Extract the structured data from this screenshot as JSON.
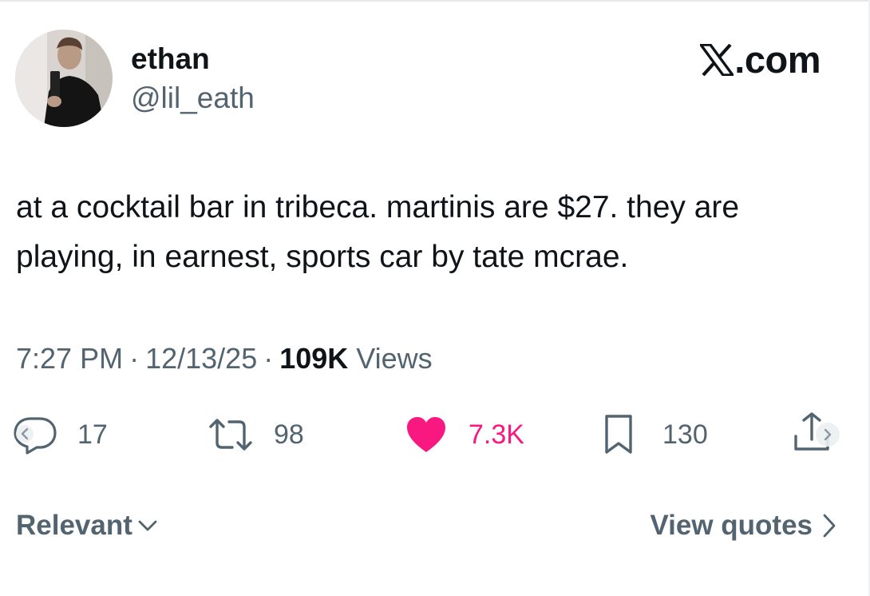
{
  "user": {
    "display_name": "ethan",
    "handle": "@lil_eath"
  },
  "brand": {
    "icon": "x-logo-icon",
    "text": ".com"
  },
  "tweet": {
    "text": "at a cocktail bar in tribeca. martinis are $27. they are playing, in earnest, sports car by tate mcrae."
  },
  "meta": {
    "time": "7:27 PM",
    "date": "12/13/25",
    "views_count": "109K",
    "views_label": "Views",
    "separator": "·"
  },
  "actions": {
    "reply": {
      "icon": "reply-bubble-icon",
      "count": "17"
    },
    "repost": {
      "icon": "repost-icon",
      "count": "98"
    },
    "like": {
      "icon": "heart-filled-icon",
      "count": "7.3K",
      "color": "#f91880"
    },
    "bookmark": {
      "icon": "bookmark-icon",
      "count": "130"
    },
    "share": {
      "icon": "share-icon"
    }
  },
  "footer": {
    "relevant_label": "Relevant",
    "view_quotes_label": "View quotes"
  },
  "colors": {
    "text_primary": "#0f1419",
    "text_secondary": "#536471",
    "like_pink": "#f91880"
  }
}
